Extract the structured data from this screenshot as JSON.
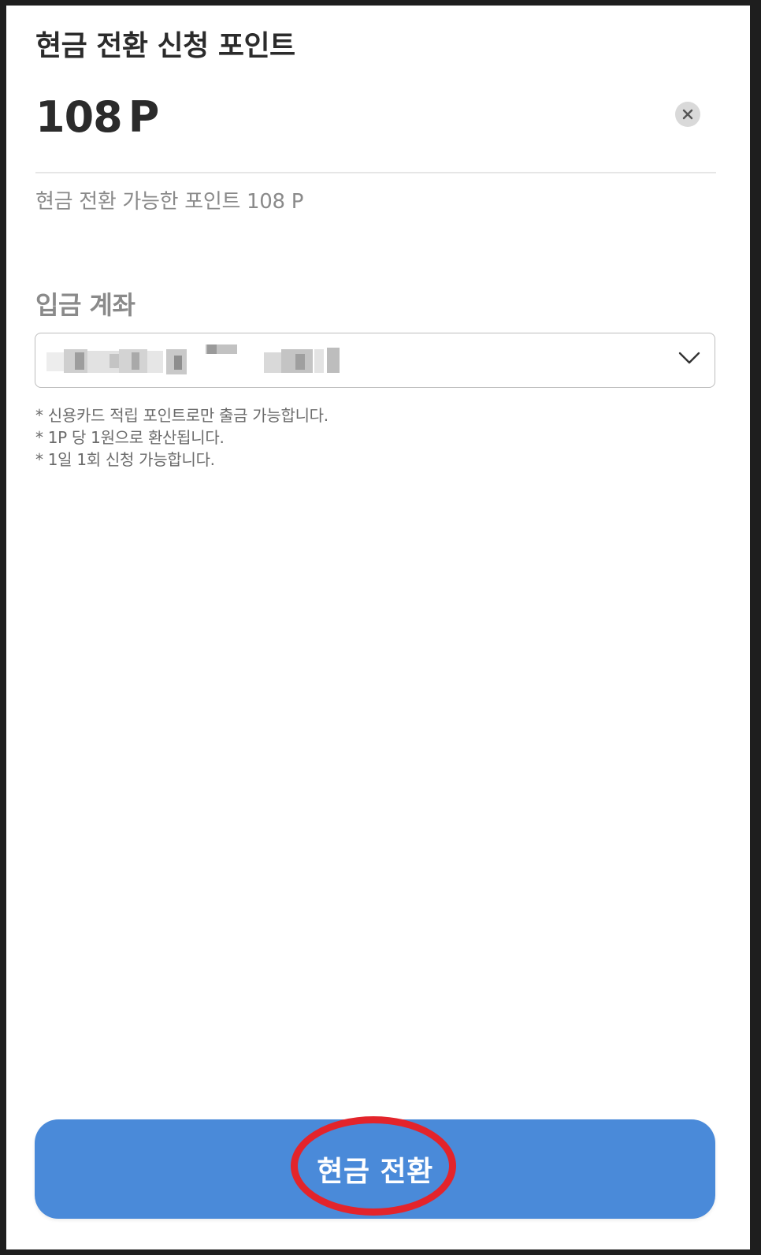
{
  "header": {
    "title": "현금 전환 신청 포인트"
  },
  "amount": {
    "value": "108",
    "unit": "P"
  },
  "available": {
    "text": "현금 전환 가능한 포인트 108 P"
  },
  "account": {
    "label": "입금 계좌"
  },
  "notes": [
    "* 신용카드 적립 포인트로만 출금 가능합니다.",
    "* 1P 당 1원으로 환산됩니다.",
    "* 1일 1회 신청 가능합니다."
  ],
  "footer": {
    "button_label": "현금 전환"
  },
  "colors": {
    "primary_button": "#4a8ad9",
    "highlight_ring": "#e3242b",
    "title_text": "#2b2b2b",
    "muted_text": "#8a8a8a"
  },
  "icons": {
    "clear": "close-icon",
    "dropdown": "chevron-down-icon"
  }
}
